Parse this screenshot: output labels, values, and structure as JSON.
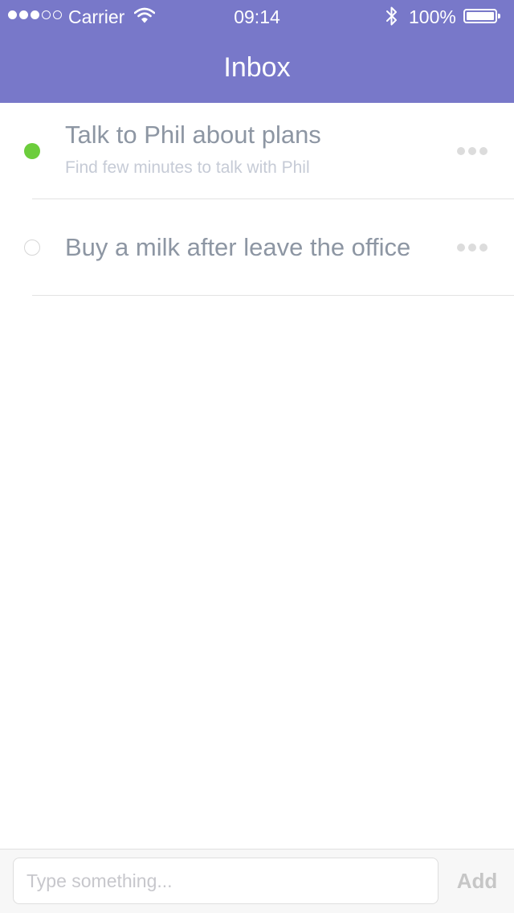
{
  "status_bar": {
    "carrier": "Carrier",
    "time": "09:14",
    "battery_text": "100%",
    "signal_bars_filled": 3,
    "signal_bars_total": 5,
    "battery_level": 1.0
  },
  "nav": {
    "title": "Inbox"
  },
  "tasks": [
    {
      "title": "Talk to Phil about plans",
      "subtitle": "Find few minutes to talk with Phil",
      "status": "done",
      "status_color": "#6ccd3c"
    },
    {
      "title": "Buy a milk after leave the office",
      "status": "open"
    }
  ],
  "composer": {
    "placeholder": "Type something...",
    "add_label": "Add"
  },
  "colors": {
    "accent": "#7878c9",
    "text_primary": "#8d96a3",
    "text_secondary": "#c6cbd6"
  }
}
